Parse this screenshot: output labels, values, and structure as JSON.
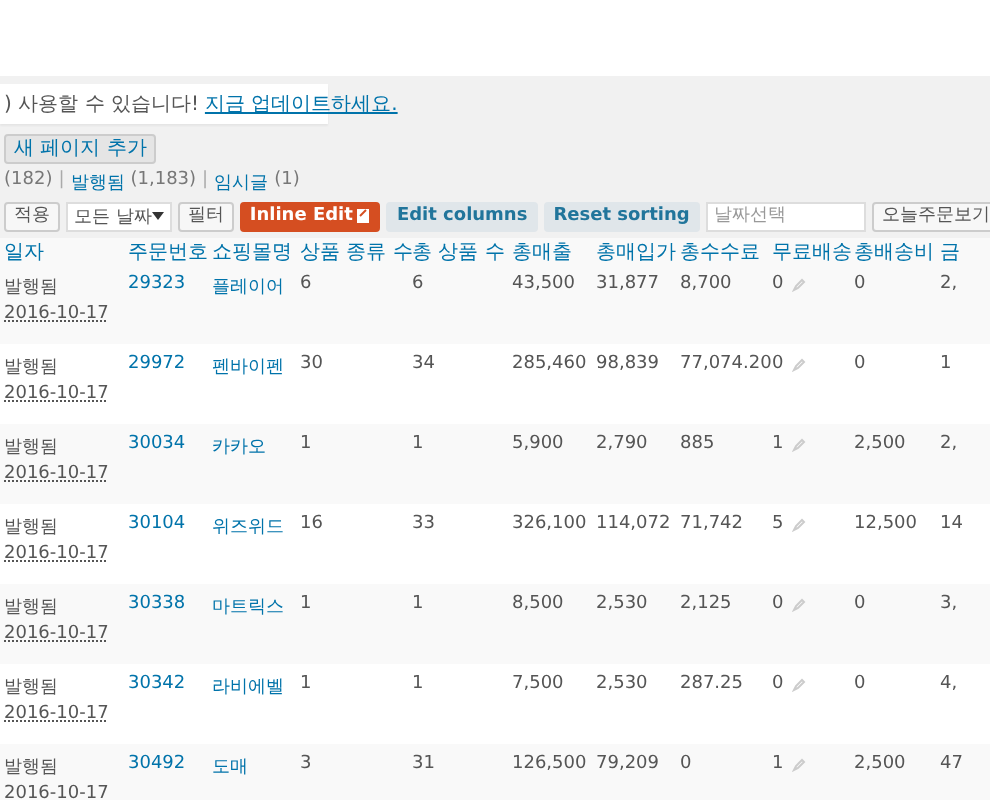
{
  "notice": {
    "text": ") 사용할 수 있습니다!",
    "link": "지금 업데이트하세요."
  },
  "add_button": "새 페이지 추가",
  "status_links": [
    {
      "label": "(182)",
      "link": false
    },
    {
      "separator": "|",
      "label": "발행됨",
      "count": "(1,183)",
      "link": true
    },
    {
      "separator": "|",
      "label": "임시글",
      "count": "(1)",
      "link": true
    }
  ],
  "toolbar": {
    "apply": "적용",
    "date_select": "모든 날짜",
    "filter": "필터",
    "inline_edit": "Inline Edit",
    "edit_columns": "Edit columns",
    "reset_sorting": "Reset sorting",
    "date_placeholder": "날짜선택",
    "today_button": "오늘주문보기"
  },
  "table": {
    "columns": [
      "일자",
      "주문번호",
      "쇼핑몰명",
      "상품 종류 수",
      "총 상품 수",
      "총매출",
      "총매입가",
      "총수수료",
      "무료배송",
      "총배송비",
      "금"
    ],
    "rows": [
      {
        "status": "발행됨",
        "date": "2016-10-17",
        "order_no": "29323",
        "shop": "플레이어",
        "product_types": "6",
        "total_items": "6",
        "sales": "43,500",
        "cost": "31,877",
        "fee": "8,700",
        "free_shipping": "0",
        "shipping": "0",
        "column_11": "2,"
      },
      {
        "status": "발행됨",
        "date": "2016-10-17",
        "order_no": "29972",
        "shop": "펜바이펜",
        "product_types": "30",
        "total_items": "34",
        "sales": "285,460",
        "cost": "98,839",
        "fee": "77,074.20",
        "free_shipping": "0",
        "shipping": "0",
        "column_11": "1"
      },
      {
        "status": "발행됨",
        "date": "2016-10-17",
        "order_no": "30034",
        "shop": "카카오",
        "product_types": "1",
        "total_items": "1",
        "sales": "5,900",
        "cost": "2,790",
        "fee": "885",
        "free_shipping": "1",
        "shipping": "2,500",
        "column_11": "2,"
      },
      {
        "status": "발행됨",
        "date": "2016-10-17",
        "order_no": "30104",
        "shop": "위즈위드",
        "product_types": "16",
        "total_items": "33",
        "sales": "326,100",
        "cost": "114,072",
        "fee": "71,742",
        "free_shipping": "5",
        "shipping": "12,500",
        "column_11": "14"
      },
      {
        "status": "발행됨",
        "date": "2016-10-17",
        "order_no": "30338",
        "shop": "마트릭스",
        "product_types": "1",
        "total_items": "1",
        "sales": "8,500",
        "cost": "2,530",
        "fee": "2,125",
        "free_shipping": "0",
        "shipping": "0",
        "column_11": "3,"
      },
      {
        "status": "발행됨",
        "date": "2016-10-17",
        "order_no": "30342",
        "shop": "라비에벨",
        "product_types": "1",
        "total_items": "1",
        "sales": "7,500",
        "cost": "2,530",
        "fee": "287.25",
        "free_shipping": "0",
        "shipping": "0",
        "column_11": "4,"
      },
      {
        "status": "발행됨",
        "date": "2016-10-17",
        "order_no": "30492",
        "shop": "도매",
        "product_types": "3",
        "total_items": "31",
        "sales": "126,500",
        "cost": "79,209",
        "fee": "0",
        "free_shipping": "1",
        "shipping": "2,500",
        "column_11": "47"
      }
    ]
  }
}
